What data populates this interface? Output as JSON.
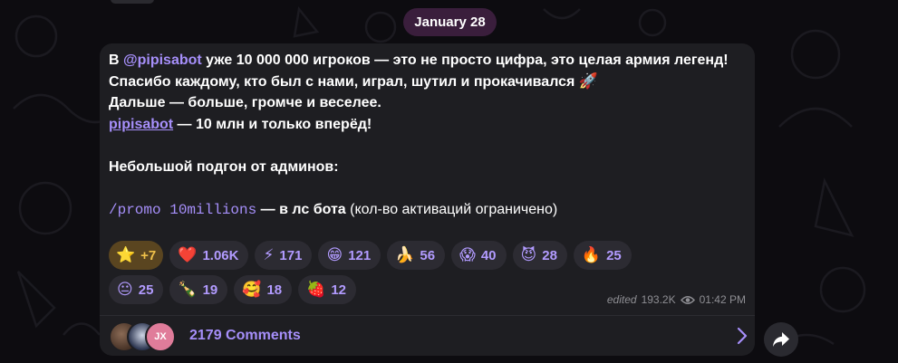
{
  "date_separator": "January 28",
  "message": {
    "line1_prefix": "В ",
    "line1_mention": "@pipisabot",
    "line1_suffix": " уже 10 000 000 игроков — это не просто цифра, это целая армия легенд!",
    "line2": "Спасибо каждому, кто был с нами, играл, шутил и прокачивался",
    "line2_emoji": "🚀",
    "line3": "Дальше — больше, громче и веселее.",
    "line4_link": "pipisabot",
    "line4_suffix": " — 10 млн и только вперёд!",
    "line5": "Небольшой подгон от админов:",
    "line6_code": "/promo 10millions",
    "line6_bold": " — в лс бота",
    "line6_normal": " (кол-во активаций ограничено)"
  },
  "reactions": [
    {
      "emoji": "⭐",
      "count": "+7",
      "kind": "star-icon"
    },
    {
      "emoji": "❤️",
      "count": "1.06K",
      "kind": "heart-icon"
    },
    {
      "emoji": "⚡",
      "count": "171",
      "kind": "lightning-icon"
    },
    {
      "emoji": "😁",
      "count": "121",
      "kind": "grin-icon"
    },
    {
      "emoji": "🍌",
      "count": "56",
      "kind": "banana-icon"
    },
    {
      "emoji": "😱",
      "count": "40",
      "kind": "scream-icon"
    },
    {
      "emoji": "😈",
      "count": "28",
      "kind": "devil-icon"
    },
    {
      "emoji": "🔥",
      "count": "25",
      "kind": "fire-icon"
    },
    {
      "emoji": "😐",
      "count": "25",
      "kind": "neutral-face-icon"
    },
    {
      "emoji": "🍾",
      "count": "19",
      "kind": "champagne-icon"
    },
    {
      "emoji": "🥰",
      "count": "18",
      "kind": "smiling-hearts-icon"
    },
    {
      "emoji": "🍓",
      "count": "12",
      "kind": "strawberry-icon"
    }
  ],
  "meta": {
    "edited": "edited",
    "views": "193.2K",
    "time": "01:42 PM"
  },
  "comments": {
    "label": "2179 Comments",
    "avatar3_initials": "JX"
  },
  "colors": {
    "accent": "#a68ffa",
    "bubble": "#1e1e22",
    "background": "#0d0c10",
    "date_pill": "#3a1e3c"
  }
}
